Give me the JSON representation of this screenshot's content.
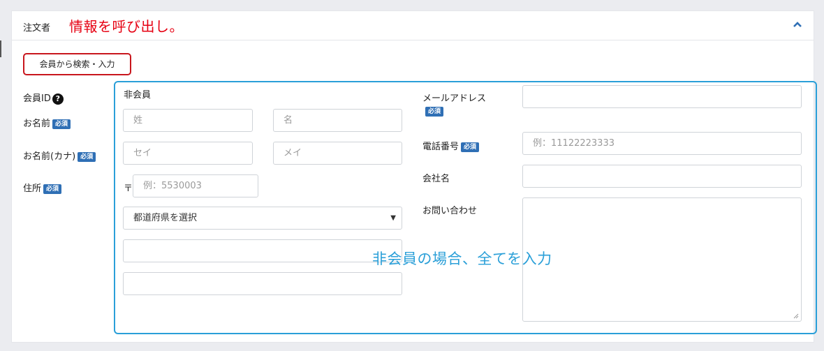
{
  "header": {
    "title": "注文者",
    "annotation": "情報を呼び出し。"
  },
  "search_button": {
    "label": "会員から検索・入力"
  },
  "left_labels": {
    "member_id": "会員ID",
    "name": "お名前",
    "name_kana": "お名前(カナ)",
    "address": "住所",
    "required_badge": "必須"
  },
  "form": {
    "non_member_label": "非会員",
    "last_name": {
      "placeholder": "姓"
    },
    "first_name": {
      "placeholder": "名"
    },
    "last_kana": {
      "placeholder": "セイ"
    },
    "first_kana": {
      "placeholder": "メイ"
    },
    "postal_mark": "〒",
    "postal": {
      "placeholder": "例：5530003"
    },
    "prefecture": {
      "selected": "都道府県を選択"
    },
    "email_label": "メールアドレス",
    "phone_label": "電話番号",
    "phone": {
      "placeholder": "例：11122223333"
    },
    "company_label": "会社名",
    "inquiry_label": "お問い合わせ"
  },
  "annotation_blue": "非会員の場合、全てを入力",
  "colors": {
    "annotation_red": "#e60012",
    "annotation_blue": "#2a9fd8",
    "badge": "#2f6fb5",
    "button_border": "#c8161d"
  },
  "icons": [
    "chevron-up-icon",
    "question-circle-icon",
    "resize-grip-icon"
  ]
}
